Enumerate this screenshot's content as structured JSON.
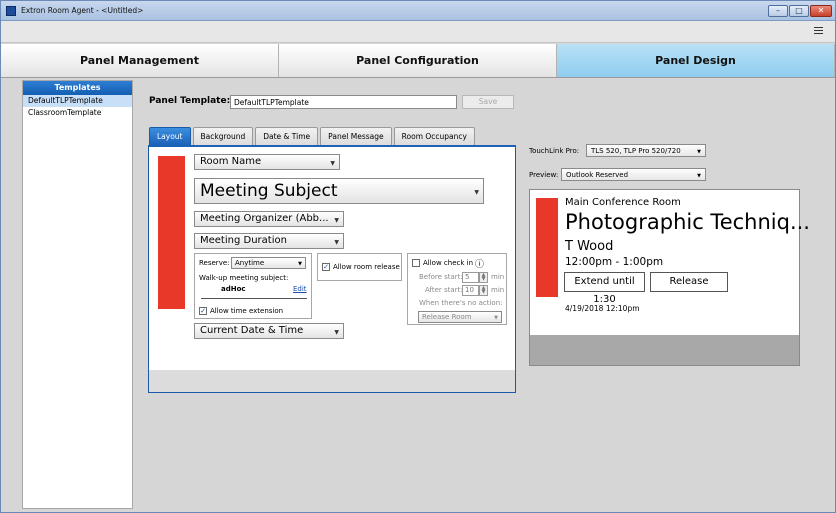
{
  "window": {
    "title": "Extron Room Agent - <Untitled>"
  },
  "main_tabs": [
    {
      "label": "Panel Management",
      "active": false
    },
    {
      "label": "Panel Configuration",
      "active": false
    },
    {
      "label": "Panel Design",
      "active": true
    }
  ],
  "sidebar": {
    "header": "Templates",
    "items": [
      {
        "label": "DefaultTLPTemplate",
        "selected": true
      },
      {
        "label": "ClassroomTemplate",
        "selected": false
      }
    ]
  },
  "panel_template": {
    "label": "Panel Template:",
    "value": "DefaultTLPTemplate",
    "save_label": "Save"
  },
  "sub_tabs": [
    "Layout",
    "Background",
    "Date & Time",
    "Panel Message",
    "Room Occupancy"
  ],
  "layout": {
    "room_name": "Room Name",
    "meeting_subject": "Meeting Subject",
    "meeting_organizer": "Meeting Organizer (Abb...",
    "meeting_duration": "Meeting Duration",
    "current_date_time": "Current Date & Time",
    "reserve_label": "Reserve:",
    "reserve_value": "Anytime",
    "walkup_label": "Walk-up meeting subject:",
    "walkup_value": "adHoc",
    "edit_link": "Edit",
    "allow_time_extension": "Allow time extension",
    "allow_room_release": "Allow room release",
    "allow_check_in": "Allow check in",
    "before_start_label": "Before start:",
    "before_start_value": "5",
    "after_start_label": "After start:",
    "after_start_value": "10",
    "min_unit": "min",
    "no_action_label": "When there's no action:",
    "no_action_value": "Release Room",
    "info_icon": "ⓘ"
  },
  "touchlink": {
    "label": "TouchLink Pro:",
    "value": "TLS 520, TLP Pro 520/720"
  },
  "preview_select": {
    "label": "Preview:",
    "value": "Outlook Reserved"
  },
  "preview": {
    "room": "Main Conference Room",
    "subject": "Photographic Techniq...",
    "organizer": "T Wood",
    "time": "12:00pm - 1:00pm",
    "extend_label": "Extend until 1:30",
    "release_label": "Release",
    "date": "4/19/2018  12:10pm"
  },
  "colors": {
    "accent_red": "#e8382a",
    "tab_active_blue": "#1b62b8",
    "panel_design_blue": "#8fcdee"
  }
}
